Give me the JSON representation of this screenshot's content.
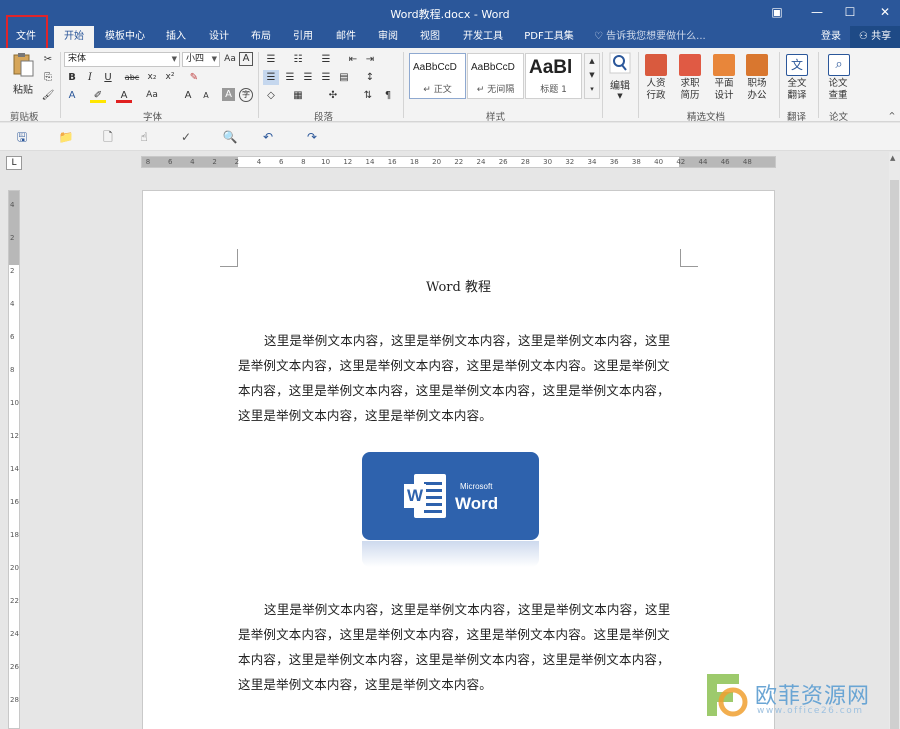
{
  "window": {
    "title": "Word教程.docx - Word",
    "accent": "#2b579a"
  },
  "tabs": {
    "file": "文件",
    "items": [
      "开始",
      "模板中心",
      "插入",
      "设计",
      "布局",
      "引用",
      "邮件",
      "审阅",
      "视图",
      "开发工具",
      "PDF工具集"
    ],
    "active": "开始",
    "tell_me": "告诉我您想要做什么...",
    "login": "登录",
    "share": "共享"
  },
  "ribbon": {
    "clipboard": {
      "paste": "粘贴",
      "label": "剪贴板"
    },
    "font": {
      "name": "宋体",
      "size": "小四",
      "label": "字体"
    },
    "paragraph": {
      "label": "段落"
    },
    "styles": {
      "label": "样式",
      "items": [
        {
          "sample": "AaBbCcD",
          "name": "↵ 正文"
        },
        {
          "sample": "AaBbCcD",
          "name": "↵ 无间隔"
        },
        {
          "sample": "AaBl",
          "name": "标题 1"
        }
      ]
    },
    "editing": {
      "label": "编辑"
    },
    "featured_docs": {
      "label": "精选文档",
      "items": [
        {
          "line1": "人资",
          "line2": "行政"
        },
        {
          "line1": "求职",
          "line2": "简历"
        },
        {
          "line1": "平面",
          "line2": "设计"
        },
        {
          "line1": "职场",
          "line2": "办公"
        }
      ]
    },
    "translate": {
      "line1": "全文",
      "line2": "翻译",
      "label": "翻译"
    },
    "paper": {
      "line1": "论文",
      "line2": "查重",
      "label": "论文"
    }
  },
  "ruler": {
    "h_numbers": [
      "8",
      "6",
      "4",
      "2",
      "2",
      "4",
      "6",
      "8",
      "10",
      "12",
      "14",
      "16",
      "18",
      "20",
      "22",
      "24",
      "26",
      "28",
      "30",
      "32",
      "34",
      "36",
      "38",
      "40",
      "42",
      "44",
      "46",
      "48"
    ],
    "v_numbers": [
      "4",
      "2",
      "2",
      "4",
      "6",
      "8",
      "10",
      "12",
      "14",
      "16",
      "18",
      "20",
      "22",
      "24",
      "26",
      "28"
    ],
    "corner": "L"
  },
  "document": {
    "title": "Word 教程",
    "para1": "这里是举例文本内容，这里是举例文本内容，这里是举例文本内容，这里是举例文本内容，这里是举例文本内容，这里是举例文本内容。这里是举例文本内容，这里是举例文本内容，这里是举例文本内容，这里是举例文本内容，这里是举例文本内容，这里是举例文本内容。",
    "para2": "这里是举例文本内容，这里是举例文本内容，这里是举例文本内容，这里是举例文本内容，这里是举例文本内容，这里是举例文本内容。这里是举例文本内容，这里是举例文本内容，这里是举例文本内容，这里是举例文本内容，这里是举例文本内容，这里是举例文本内容。",
    "logo": {
      "ms": "Microsoft",
      "word": "Word",
      "letter": "W"
    }
  },
  "watermark": {
    "text": "欧菲资源网",
    "url": "www.office26.com"
  }
}
